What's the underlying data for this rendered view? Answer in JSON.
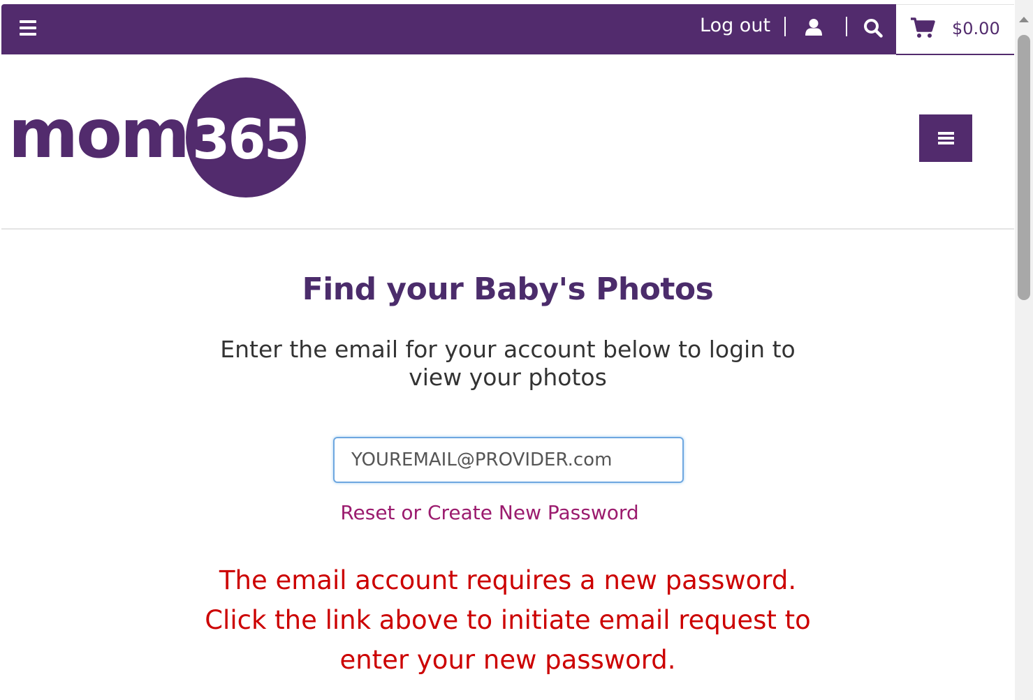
{
  "topbar": {
    "logout_label": "Log out",
    "cart_total": "$0.00",
    "background_color": "#522b6d"
  },
  "header": {
    "logo_text": "mom",
    "logo_number": "365",
    "brand_color": "#522b6d"
  },
  "main": {
    "title": "Find your Baby's Photos",
    "subtitle": "Enter the email for your account below to login to view your photos",
    "email_value": "YOUREMAIL@PROVIDER.com",
    "reset_link_label": "Reset or Create New Password",
    "error_message": "The email account requires a new password. Click the link above to initiate email request to enter your new password.",
    "error_color": "#cc0000",
    "link_color": "#9b1b6e"
  },
  "icons": {
    "menu": "hamburger-menu-icon",
    "user": "user-icon",
    "search": "search-icon",
    "cart": "shopping-cart-icon"
  }
}
